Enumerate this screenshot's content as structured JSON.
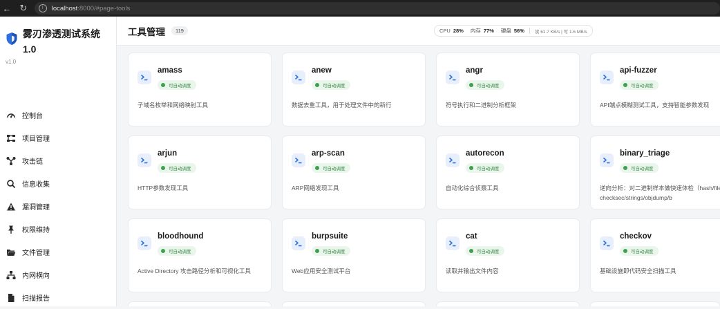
{
  "browser": {
    "url_host": "localhost",
    "url_path": ":8000/#page-tools"
  },
  "sidebar": {
    "brand_name": "雾刃渗透测试系统 1.0",
    "version": "v1.0",
    "items": [
      {
        "label": "控制台",
        "icon": "dashboard-icon"
      },
      {
        "label": "项目管理",
        "icon": "sitemap-icon"
      },
      {
        "label": "攻击链",
        "icon": "network-icon"
      },
      {
        "label": "信息收集",
        "icon": "search-icon"
      },
      {
        "label": "漏洞管理",
        "icon": "warning-icon"
      },
      {
        "label": "权限维持",
        "icon": "pin-icon"
      },
      {
        "label": "文件管理",
        "icon": "folder-icon"
      },
      {
        "label": "内网横向",
        "icon": "hierarchy-icon"
      },
      {
        "label": "扫描报告",
        "icon": "file-icon"
      }
    ]
  },
  "header": {
    "title": "工具管理",
    "count": "119",
    "stats": {
      "cpu_label": "CPU",
      "cpu_value": "28%",
      "mem_label": "内存",
      "mem_value": "77%",
      "disk_label": "硬盘",
      "disk_value": "56%",
      "net_text": "读 61.7 KB/s | 写 1.6 MB/s"
    }
  },
  "status_label": "可自动调度",
  "colors": {
    "accent_blue": "#2f6fe4",
    "status_green": "#3fa14f",
    "status_bg": "#eaf6ec"
  },
  "tools": [
    {
      "name": "amass",
      "desc": "子域名枚举和网络映射工具"
    },
    {
      "name": "anew",
      "desc": "数据去重工具，用于处理文件中的新行"
    },
    {
      "name": "angr",
      "desc": "符号执行和二进制分析框架"
    },
    {
      "name": "api-fuzzer",
      "desc": "API端点模糊测试工具，支持智能参数发现"
    },
    {
      "name": "arjun",
      "desc": "HTTP参数发现工具"
    },
    {
      "name": "arp-scan",
      "desc": "ARP网络发现工具"
    },
    {
      "name": "autorecon",
      "desc": "自动化综合侦察工具"
    },
    {
      "name": "binary_triage",
      "desc": "逆向分析：对二进制样本做快速体检（hash/file/checksec/strings/objdump/b"
    },
    {
      "name": "bloodhound",
      "desc": "Active Directory 攻击路径分析和可视化工具"
    },
    {
      "name": "burpsuite",
      "desc": "Web应用安全测试平台"
    },
    {
      "name": "cat",
      "desc": "读取并输出文件内容"
    },
    {
      "name": "checkov",
      "desc": "基础设施即代码安全扫描工具"
    }
  ]
}
